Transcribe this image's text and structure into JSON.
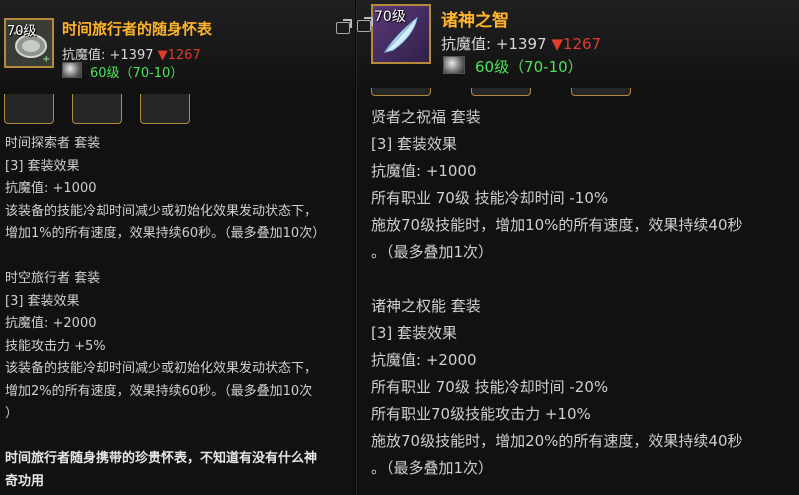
{
  "left": {
    "level_badge": "70级",
    "title": "时间旅行者的随身怀表",
    "stat_label": "抗魔值: +1397",
    "stat_down": "▼1267",
    "level_range": "60级（70-10）",
    "lines": [
      "时间探索者 套装",
      "[3] 套装效果",
      "抗魔值: +1000",
      "该装备的技能冷却时间减少或初始化效果发动状态下，",
      "增加1%的所有速度，效果持续60秒。（最多叠加10次）",
      "",
      "时空旅行者 套装",
      "[3] 套装效果",
      "抗魔值: +2000",
      "技能攻击力 +5%",
      "该装备的技能冷却时间减少或初始化效果发动状态下，",
      "增加2%的所有速度，效果持续60秒。（最多叠加10次",
      "）",
      "",
      "时间旅行者随身携带的珍贵怀表，不知道有没有什么神",
      "奇功用"
    ]
  },
  "right": {
    "level_badge": "70级",
    "title": "诸神之智",
    "stat_label": "抗魔值: +1397",
    "stat_down": "▼1267",
    "level_range": "60级（70-10）",
    "lines": [
      "贤者之祝福 套装",
      "[3] 套装效果",
      "抗魔值: +1000",
      "所有职业 70级 技能冷却时间 -10%",
      "施放70级技能时，增加10%的所有速度，效果持续40秒",
      "。（最多叠加1次）",
      "",
      "诸神之权能 套装",
      "[3] 套装效果",
      "抗魔值: +2000",
      "所有职业 70级 技能冷却时间 -20%",
      "所有职业70级技能攻击力 +10%",
      "施放70级技能时，增加20%的所有速度，效果持续40秒",
      "。（最多叠加1次）"
    ]
  },
  "colors": {
    "title": "#ffb42a",
    "level_green": "#4ee25a",
    "stat_down_red": "#e23b2b",
    "border_gold": "#b58a3a"
  },
  "icons": {
    "left_item": "pocket-watch-icon",
    "right_item": "feather-quill-icon",
    "gem": "gem-icon",
    "external": "external-link-icon"
  }
}
